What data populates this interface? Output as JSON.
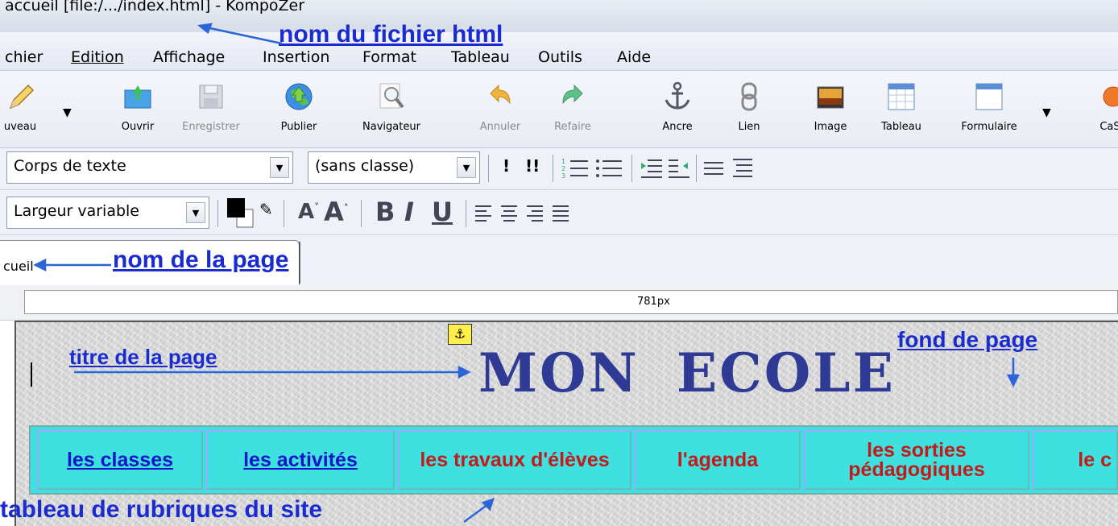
{
  "window": {
    "title": "accueil [file:/.../index.html] - KompoZer"
  },
  "menubar": {
    "items": [
      {
        "label": "chier"
      },
      {
        "label": "Edition"
      },
      {
        "label": "Affichage"
      },
      {
        "label": "Insertion"
      },
      {
        "label": "Format"
      },
      {
        "label": "Tableau"
      },
      {
        "label": "Outils"
      },
      {
        "label": "Aide"
      }
    ]
  },
  "toolbar": {
    "buttons": [
      {
        "label": "uveau",
        "icon": "pencil-icon",
        "enabled": true
      },
      {
        "label": "Ouvrir",
        "icon": "open-folder-icon",
        "enabled": true
      },
      {
        "label": "Enregistrer",
        "icon": "save-disk-icon",
        "enabled": false
      },
      {
        "label": "Publier",
        "icon": "globe-icon",
        "enabled": true
      },
      {
        "label": "Navigateur",
        "icon": "magnifier-icon",
        "enabled": true
      },
      {
        "label": "Annuler",
        "icon": "undo-icon",
        "enabled": false
      },
      {
        "label": "Refaire",
        "icon": "redo-icon",
        "enabled": false
      },
      {
        "label": "Ancre",
        "icon": "anchor-icon",
        "enabled": true
      },
      {
        "label": "Lien",
        "icon": "link-icon",
        "enabled": true
      },
      {
        "label": "Image",
        "icon": "image-icon",
        "enabled": true
      },
      {
        "label": "Tableau",
        "icon": "table-icon",
        "enabled": true
      },
      {
        "label": "Formulaire",
        "icon": "form-icon",
        "enabled": true
      },
      {
        "label": "CaS",
        "icon": "spellcheck-icon",
        "enabled": true
      }
    ]
  },
  "format1": {
    "paragraph_style": "Corps de texte",
    "class_style": "(sans classe)"
  },
  "format2": {
    "font": "Largeur variable",
    "bold": "B",
    "italic": "I",
    "underline": "U"
  },
  "tab": {
    "label": "cueil"
  },
  "ruler": {
    "width_label": "781px"
  },
  "document": {
    "heading": "MON ECOLE",
    "nav": [
      {
        "label": "les classes",
        "style": "link"
      },
      {
        "label": "les activités",
        "style": "link"
      },
      {
        "label": "les travaux d'élèves",
        "style": "red"
      },
      {
        "label": "l'agenda",
        "style": "red"
      },
      {
        "label": "les sorties pédagogiques",
        "style": "red"
      },
      {
        "label": "le c",
        "style": "link"
      }
    ]
  },
  "annotations": {
    "file_name": "nom du fichier html",
    "page_name": "nom de la page",
    "page_title": "titre de la page",
    "background": "fond de page",
    "nav_table": "tableau de rubriques du site"
  },
  "colors": {
    "annotation": "#1a2bd0",
    "heading": "#2e3a93",
    "nav_bg": "#3ee0e0",
    "link": "#1515c8",
    "red": "#c41a1a"
  }
}
